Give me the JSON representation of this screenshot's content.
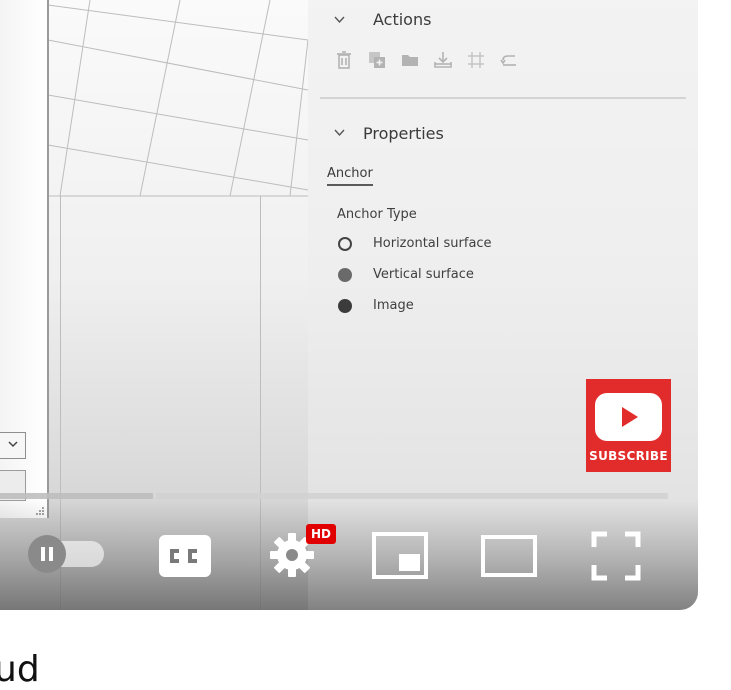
{
  "panel": {
    "actions_header": "Actions",
    "action_icons": [
      "trash-icon",
      "duplicate-icon",
      "folder-icon",
      "download-icon",
      "crop-icon",
      "undo-icon"
    ],
    "properties_header": "Properties",
    "anchor_tab": "Anchor",
    "anchor_type_label": "Anchor Type",
    "anchor_options": [
      {
        "label": "Horizontal surface",
        "selected": false
      },
      {
        "label": "Vertical surface",
        "selected": true
      },
      {
        "label": "Image",
        "selected": true
      }
    ]
  },
  "subscribe": {
    "label": "SUBSCRIBE",
    "color": "#e22b2b"
  },
  "player": {
    "hd_badge": "HD",
    "hd_color": "#e00000",
    "controls": [
      "pause-icon",
      "cc-icon",
      "settings-gear-icon",
      "miniplayer-icon",
      "theater-mode-icon",
      "fullscreen-icon"
    ]
  },
  "below_video_text": "ud"
}
